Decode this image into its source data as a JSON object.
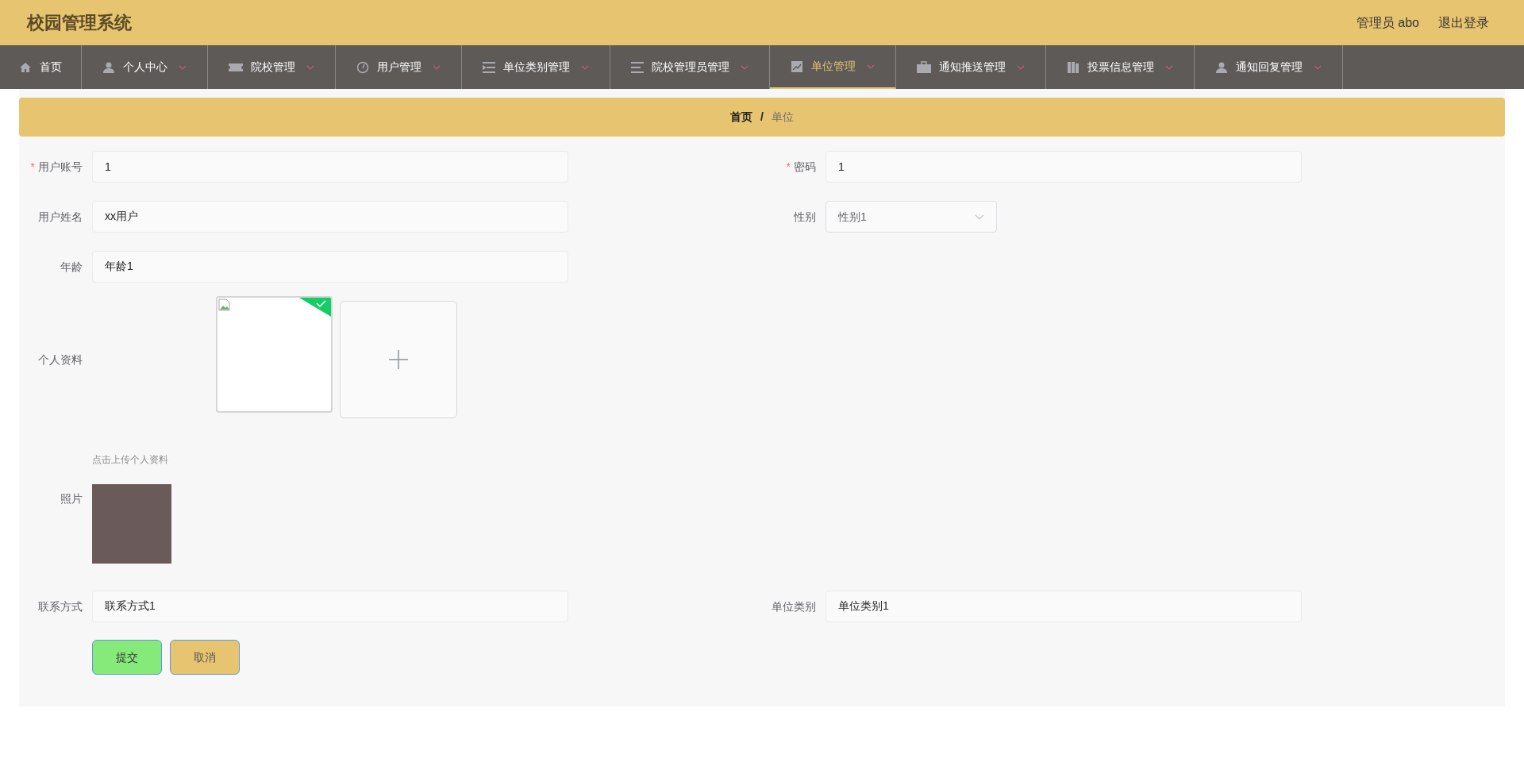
{
  "header": {
    "title": "校园管理系统",
    "user": "管理员 abo",
    "logout": "退出登录"
  },
  "nav": [
    {
      "label": "首页",
      "has_menu": false,
      "selected": false
    },
    {
      "label": "个人中心",
      "has_menu": true,
      "selected": false
    },
    {
      "label": "院校管理",
      "has_menu": true,
      "selected": false
    },
    {
      "label": "用户管理",
      "has_menu": true,
      "selected": false
    },
    {
      "label": "单位类别管理",
      "has_menu": true,
      "selected": false
    },
    {
      "label": "院校管理员管理",
      "has_menu": true,
      "selected": false
    },
    {
      "label": "单位管理",
      "has_menu": true,
      "selected": true
    },
    {
      "label": "通知推送管理",
      "has_menu": true,
      "selected": false
    },
    {
      "label": "投票信息管理",
      "has_menu": true,
      "selected": false
    },
    {
      "label": "通知回复管理",
      "has_menu": true,
      "selected": false
    }
  ],
  "breadcrumb": {
    "items": [
      "首页",
      "单位"
    ],
    "separator": "/"
  },
  "form": {
    "rows": [
      [
        {
          "kind": "input",
          "label": "用户账号",
          "required_mark": "*",
          "value": "1"
        },
        {
          "kind": "input",
          "label": "密码",
          "required_mark": "*",
          "value": "1"
        }
      ],
      [
        {
          "kind": "input",
          "label": "用户姓名",
          "value": "xx用户"
        },
        {
          "kind": "select",
          "label": "性别",
          "value": "性别1"
        }
      ],
      [
        {
          "kind": "input",
          "label": "年龄",
          "value": "年龄1"
        }
      ],
      [
        {
          "kind": "upload",
          "label": "个人资料",
          "uploaded": true,
          "hint": "点击上传个人资料"
        }
      ],
      [
        {
          "kind": "image",
          "label": "照片"
        }
      ],
      [
        {
          "kind": "input",
          "label": "联系方式",
          "value": "联系方式1"
        },
        {
          "kind": "input",
          "label": "单位类别",
          "value": "单位类别1"
        }
      ]
    ],
    "buttons": [
      {
        "kind": "submit",
        "label": "提交"
      },
      {
        "kind": "cancel",
        "label": "取消"
      }
    ]
  }
}
